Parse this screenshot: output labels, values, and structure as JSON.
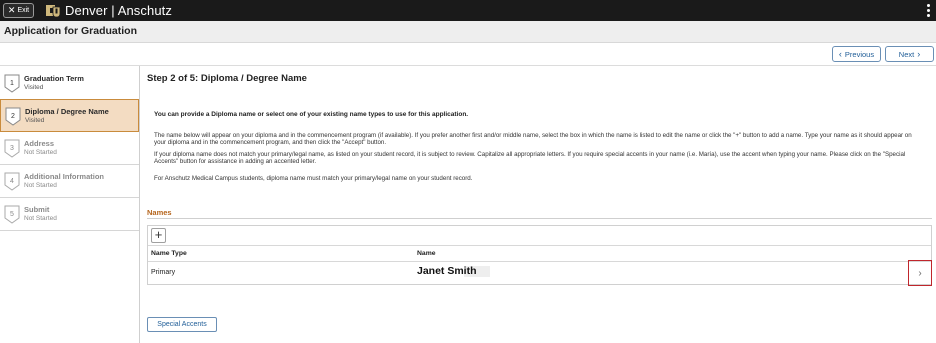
{
  "topbar": {
    "exit_label": "Exit",
    "exit_icon": "close-icon",
    "brand": "Denver | Anschutz",
    "logo_icon": "cu-logo-icon",
    "menu_icon": "kebab-menu-icon"
  },
  "page": {
    "title": "Application for Graduation"
  },
  "nav": {
    "previous_label": "Previous",
    "next_label": "Next",
    "prev_icon": "chevron-left-icon",
    "next_icon": "chevron-right-icon"
  },
  "steps": [
    {
      "number": "1",
      "title": "Graduation Term",
      "status": "Visited",
      "active": false,
      "enabled": true
    },
    {
      "number": "2",
      "title": "Diploma / Degree Name",
      "status": "Visited",
      "active": true,
      "enabled": true
    },
    {
      "number": "3",
      "title": "Address",
      "status": "Not Started",
      "active": false,
      "enabled": false
    },
    {
      "number": "4",
      "title": "Additional Information",
      "status": "Not Started",
      "active": false,
      "enabled": false
    },
    {
      "number": "5",
      "title": "Submit",
      "status": "Not Started",
      "active": false,
      "enabled": false
    }
  ],
  "content": {
    "heading": "Step 2 of 5: Diploma / Degree Name",
    "intro": "You can provide a Diploma name or select one of your existing name types to use for this application.",
    "para1": "The name below will appear on your diploma and in the commencement program (if available). If you prefer another first and/or middle name, select the box in which the name is listed to edit the name or click the \"+\" button to add a name. Type your name as it should appear on your diploma and in the commencement program, and then click the \"Accept\" button.",
    "para2": "If your diploma name does not match your primary/legal name, as listed on your student record, it is subject to review. Capitalize all appropriate letters. If you require special accents in your name (i.e. María), use the accent when typing your name. Please click on the \"Special Accents\" button for assistance in adding an accented letter.",
    "para3": "For Anschutz Medical Campus students, diploma name must match your primary/legal name on your student record."
  },
  "names": {
    "section_label": "Names",
    "add_label": "+",
    "columns": [
      "Name Type",
      "Name"
    ],
    "rows": [
      {
        "type": "Primary",
        "name": "Janet Smith"
      }
    ],
    "row_action_icon": "chevron-right-icon"
  },
  "special_accents_label": "Special Accents",
  "colors": {
    "topbar": "#1a1a1a",
    "active_step_bg": "#f3dcc2",
    "section_label": "#b5651d",
    "link_blue": "#1f5d97",
    "highlight_red": "#c0262c"
  }
}
